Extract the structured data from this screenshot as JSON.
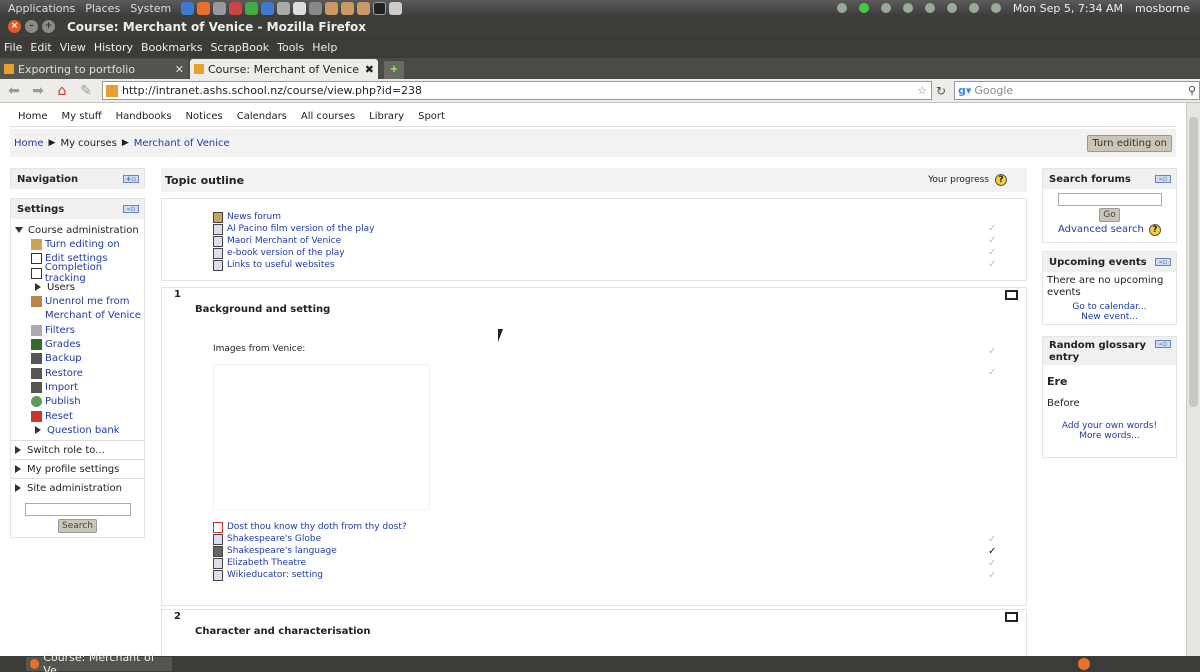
{
  "gnome_panel": {
    "menus": [
      "Applications",
      "Places",
      "System"
    ],
    "clock": "Mon Sep  5,  7:34 AM",
    "user": "mosborne"
  },
  "window": {
    "title": "Course: Merchant of Venice - Mozilla Firefox"
  },
  "menubar": [
    "File",
    "Edit",
    "View",
    "History",
    "Bookmarks",
    "ScrapBook",
    "Tools",
    "Help"
  ],
  "tabs": [
    {
      "label": "Exporting to portfolio"
    },
    {
      "label": "Course: Merchant of Venice"
    }
  ],
  "urlbar": {
    "url": "http://intranet.ashs.school.nz/course/view.php?id=238"
  },
  "searchbar": {
    "placeholder": "Google"
  },
  "site_nav": [
    "Home",
    "My stuff",
    "Handbooks",
    "Notices",
    "Calendars",
    "All courses",
    "Library",
    "Sport"
  ],
  "breadcrumb": {
    "items": [
      "Home",
      "My courses",
      "Merchant of Venice"
    ],
    "separator": "▶"
  },
  "turn_editing_on_button": "Turn editing on",
  "navigation_block": {
    "title": "Navigation"
  },
  "settings_block": {
    "title": "Settings",
    "course_admin": "Course administration",
    "items": [
      {
        "label": "Turn editing on",
        "icon": "edit-icon"
      },
      {
        "label": "Edit settings",
        "icon": "settings-icon"
      },
      {
        "label": "Completion tracking",
        "icon": "completion-icon"
      },
      {
        "label": "Users",
        "icon": "folder-icon"
      },
      {
        "label": "Unenrol me from",
        "icon": "unenrol-icon"
      },
      {
        "label": "Merchant of Venice",
        "icon": ""
      },
      {
        "label": "Filters",
        "icon": "filter-icon"
      },
      {
        "label": "Grades",
        "icon": "grades-icon"
      },
      {
        "label": "Backup",
        "icon": "backup-icon"
      },
      {
        "label": "Restore",
        "icon": "restore-icon"
      },
      {
        "label": "Import",
        "icon": "import-icon"
      },
      {
        "label": "Publish",
        "icon": "publish-icon"
      },
      {
        "label": "Reset",
        "icon": "reset-icon"
      },
      {
        "label": "Question bank",
        "icon": "folder-icon"
      }
    ],
    "switch_role": "Switch role to...",
    "my_profile": "My profile settings",
    "site_admin": "Site administration",
    "search_button": "Search"
  },
  "topic_outline": {
    "title": "Topic outline",
    "progress_label": "Your progress",
    "help": "?"
  },
  "section0": {
    "activities": [
      {
        "label": "News forum",
        "icon": "forum-icon"
      },
      {
        "label": "Al Pacino film version of the play",
        "icon": "page-icon"
      },
      {
        "label": "Maori Merchant of Venice",
        "icon": "page-icon"
      },
      {
        "label": "e-book version of the play",
        "icon": "page-icon"
      },
      {
        "label": "Links to useful websites",
        "icon": "page-icon"
      }
    ]
  },
  "section1": {
    "number": "1",
    "title": "Background and setting",
    "label_text": "Images from Venice:",
    "activities": [
      {
        "label": "Dost thou know thy doth from thy dost?",
        "icon": "quiz-icon"
      },
      {
        "label": "Shakespeare's Globe",
        "icon": "page-icon"
      },
      {
        "label": "Shakespeare's language",
        "icon": "glossary-icon"
      },
      {
        "label": "Elizabeth Theatre",
        "icon": "page-icon"
      },
      {
        "label": "Wikieducator: setting",
        "icon": "page-icon"
      }
    ]
  },
  "section2": {
    "number": "2",
    "title": "Character and characterisation"
  },
  "search_forums": {
    "title": "Search forums",
    "go_button": "Go",
    "advanced": "Advanced search"
  },
  "upcoming_events": {
    "title": "Upcoming events",
    "text": "There are no upcoming events",
    "calendar_link": "Go to calendar...",
    "new_event_link": "New event..."
  },
  "random_glossary": {
    "title": "Random glossary entry",
    "term": "Ere",
    "definition": "Before",
    "add_link": "Add your own words!",
    "more_link": "More words..."
  },
  "taskbar": {
    "item": "Course: Merchant of Ve..."
  }
}
